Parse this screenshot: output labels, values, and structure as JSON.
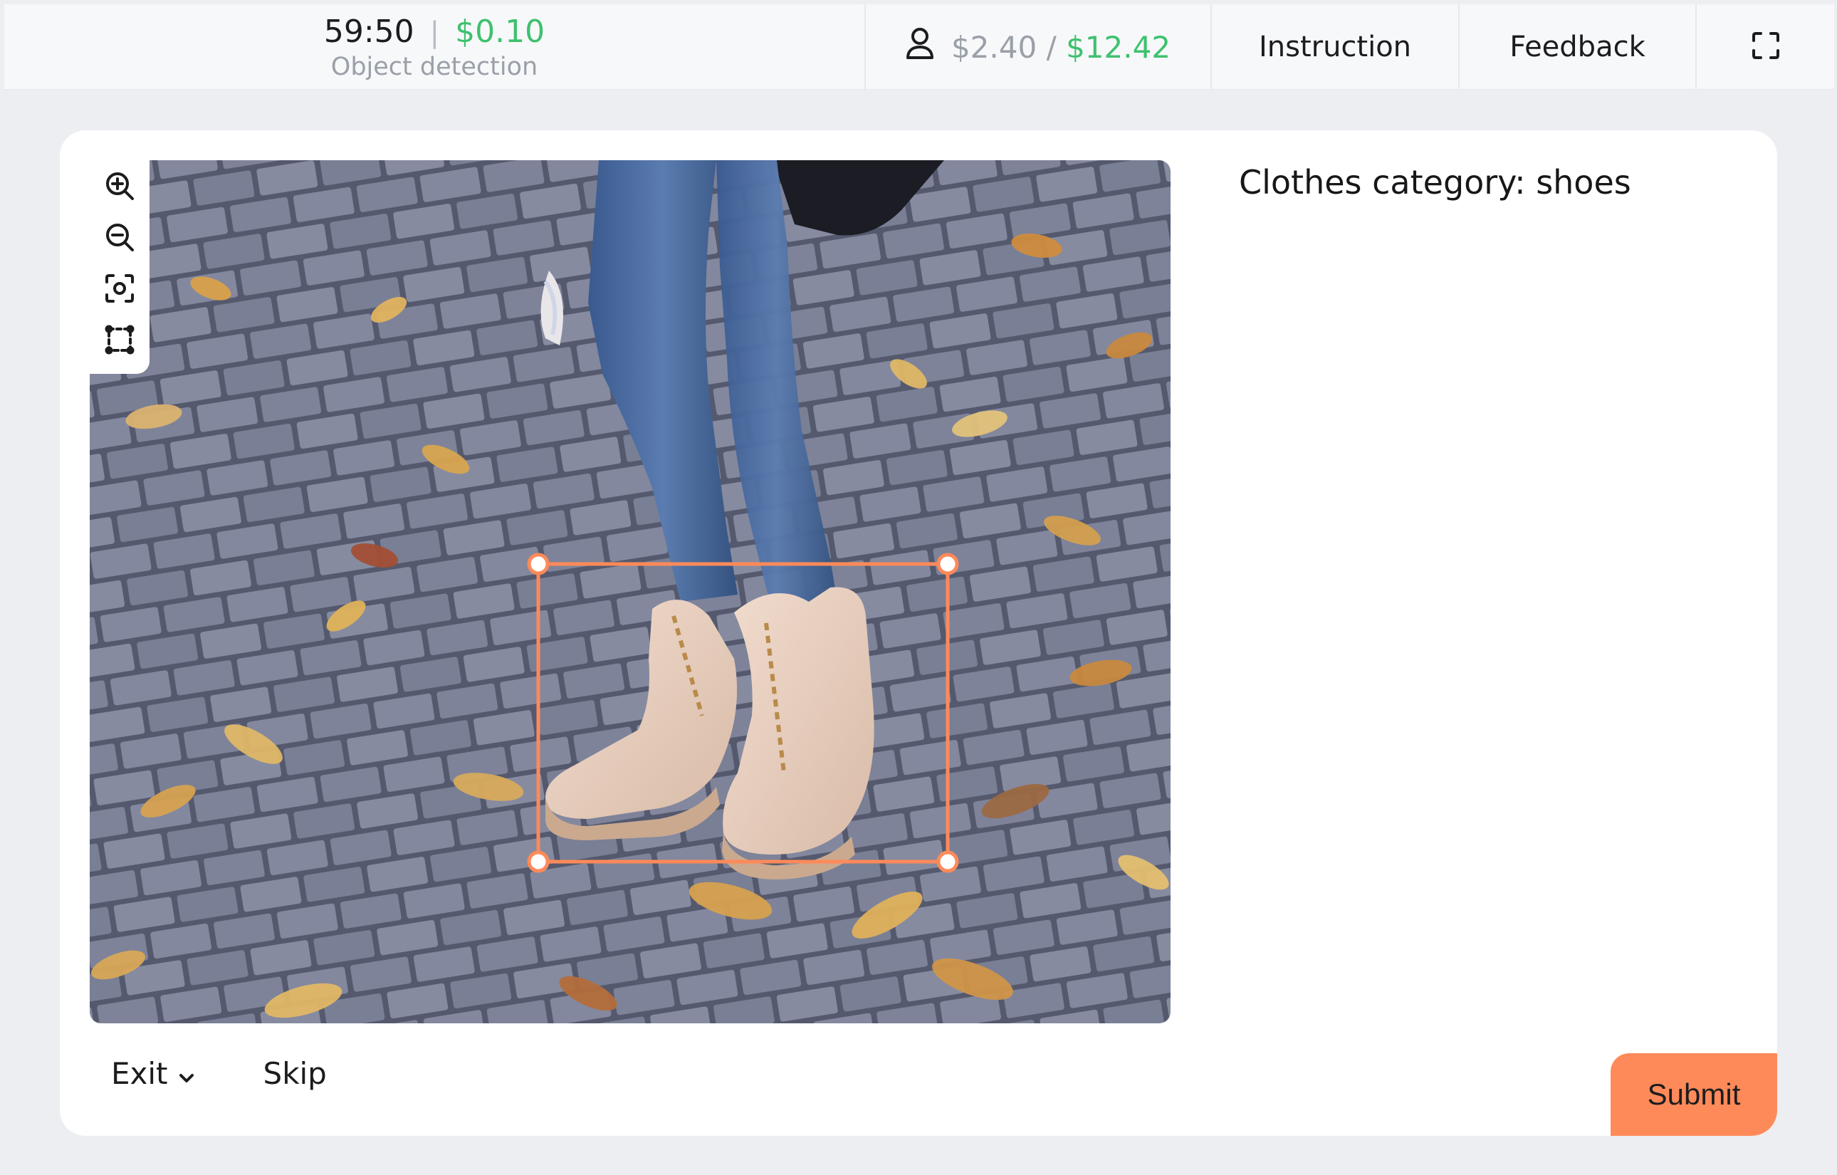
{
  "topbar": {
    "timer": "59:50",
    "separator": "|",
    "task_reward": "$0.10",
    "task_type": "Object detection",
    "earned": "$2.40",
    "earn_separator": "/",
    "total": "$12.42",
    "instruction_label": "Instruction",
    "feedback_label": "Feedback",
    "icons": {
      "user": "user-icon",
      "fullscreen": "fullscreen-icon"
    }
  },
  "toolbar": {
    "tools": [
      "zoom-in-icon",
      "zoom-out-icon",
      "focus-icon",
      "bounding-box-icon"
    ]
  },
  "task": {
    "category_text": "Clothes category: shoes",
    "bounding_box_color": "#ff8a59"
  },
  "footer": {
    "exit_label": "Exit",
    "skip_label": "Skip",
    "submit_label": "Submit"
  },
  "colors": {
    "accent_green": "#3ec16f",
    "accent_orange": "#ff8a59",
    "muted_text": "#9aa0a8"
  }
}
